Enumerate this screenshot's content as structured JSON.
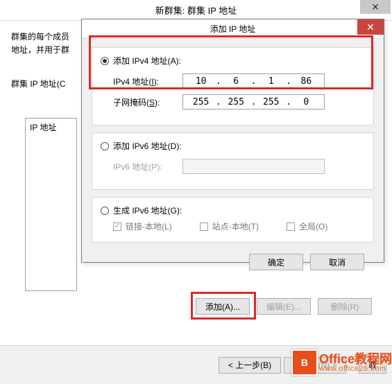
{
  "parent": {
    "title": "新群集: 群集 IP 地址",
    "intro_line1": "群集的每个成员",
    "intro_line2": "地址，并用于群",
    "list_label": "群集 IP 地址(C",
    "list_header": "IP 地址",
    "close_glyph": "✕",
    "buttons": {
      "add": "添加(A)...",
      "edit": "编辑(E)...",
      "remove": "删除(R)"
    },
    "wizard": {
      "back": "< 上一步(B)",
      "next": "下一步(N) >",
      "cancel_prefix": "取"
    }
  },
  "child": {
    "title": "添加 IP 地址",
    "close_glyph": "✕",
    "ipv4": {
      "radio": "添加 IPv4 地址(A):",
      "addr_label": "IPv4 地址(I):",
      "addr_octets": [
        "10",
        "6",
        "1",
        "86"
      ],
      "mask_label": "子网掩码(S):",
      "mask_octets": [
        "255",
        "255",
        "255",
        "0"
      ]
    },
    "ipv6": {
      "radio": "添加 IPv6 地址(D):",
      "addr_label": "IPv6 地址(P):"
    },
    "gen6": {
      "radio": "生成 IPv6 地址(G):",
      "link_local": "链接-本地(L)",
      "site_local": "站点-本地(T)",
      "global": "全局(O)"
    },
    "buttons": {
      "ok": "确定",
      "cancel": "取消"
    }
  },
  "watermark": {
    "logo_initial": "B",
    "name": "Office教程网",
    "url": "www.office26.com"
  }
}
